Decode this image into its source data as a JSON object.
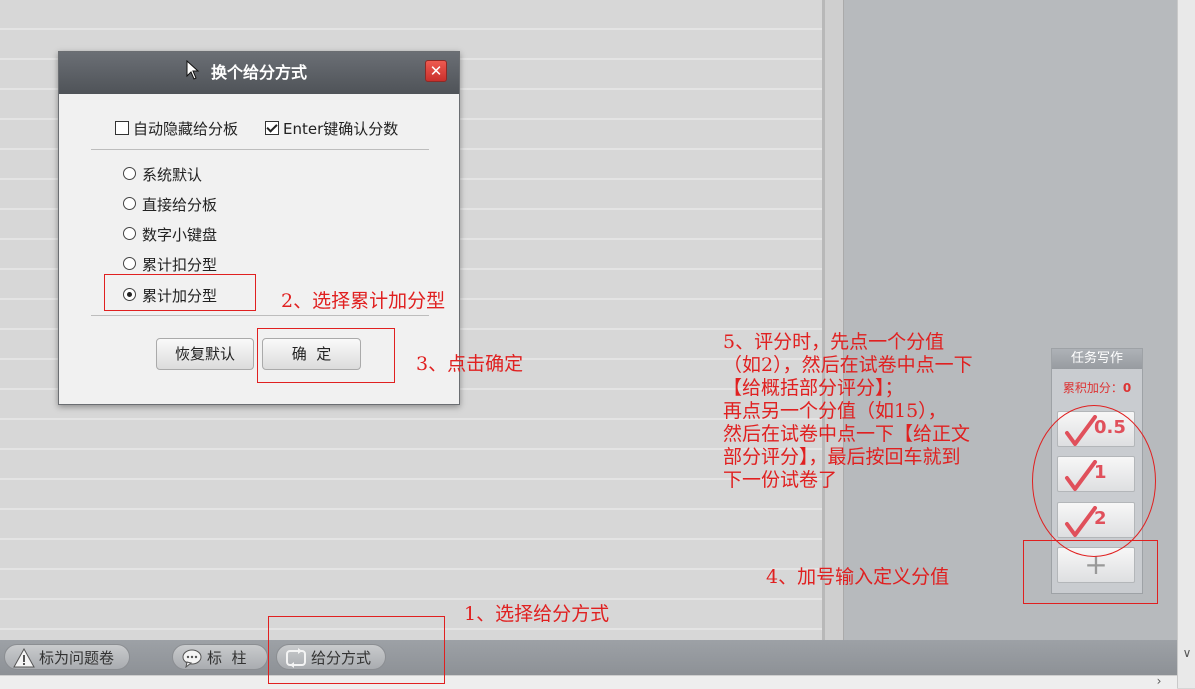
{
  "dialog": {
    "title": "换个给分方式",
    "close_icon": "close-icon",
    "checkboxes": [
      {
        "label": "自动隐藏给分板",
        "checked": false
      },
      {
        "label": "Enter键确认分数",
        "checked": true
      }
    ],
    "radio_options": [
      {
        "label": "系统默认",
        "selected": false
      },
      {
        "label": "直接给分板",
        "selected": false
      },
      {
        "label": "数字小键盘",
        "selected": false
      },
      {
        "label": "累计扣分型",
        "selected": false
      },
      {
        "label": "累计加分型",
        "selected": true
      }
    ],
    "restore_button": "恢复默认",
    "ok_button": "确  定"
  },
  "score_panel": {
    "title": "任务写作",
    "total_label": "累积加分：",
    "total_value": "0",
    "buttons": [
      "0.5",
      "1",
      "2"
    ],
    "plus_label": "+"
  },
  "toolbar": {
    "problem_label": "标为问题卷",
    "mark_label": "标  柱",
    "method_label": "给分方式"
  },
  "annotations": {
    "step1": "1、选择给分方式",
    "step2": "2、选择累计加分型",
    "step3": "3、点击确定",
    "step4": "4、加号输入定义分值",
    "step5": "5、评分时，先点一个分值\n（如2），然后在试卷中点一下\n【给概括部分评分】；\n再点另一个分值（如15），\n然后在试卷中点一下【给正文\n部分评分】，最后按回车就到\n下一份试卷了"
  },
  "colors": {
    "annotation": "#e02020",
    "score_value": "#e0505b",
    "close_button": "#d9403a",
    "titlebar": "#5b5f64",
    "toolbar": "#969a9f"
  }
}
